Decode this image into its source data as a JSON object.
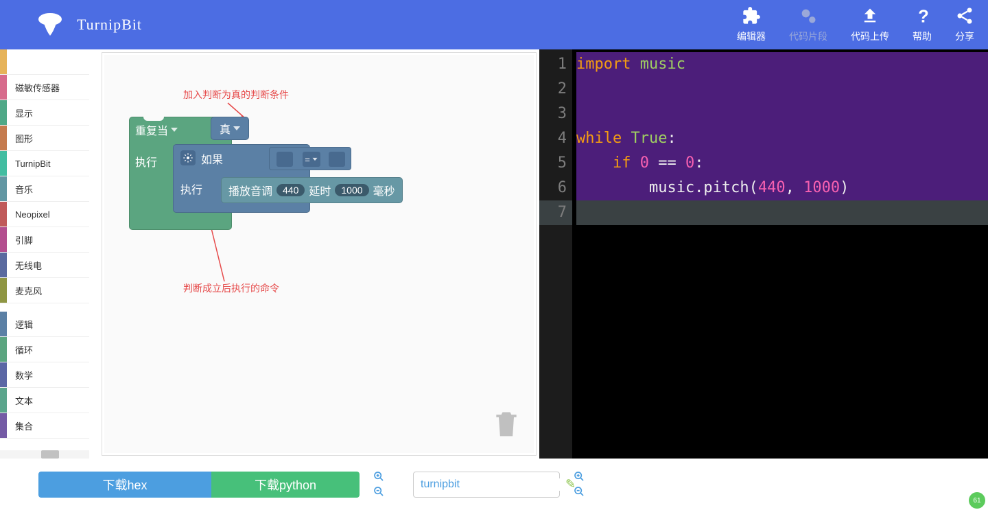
{
  "app_title": "TurnipBit",
  "nav": [
    {
      "label": "编辑器"
    },
    {
      "label": "代码片段"
    },
    {
      "label": "代码上传"
    },
    {
      "label": "帮助"
    },
    {
      "label": "分享"
    }
  ],
  "sidebar": [
    {
      "label": "",
      "color": "#E6B35A"
    },
    {
      "label": "磁敏传感器",
      "color": "#D76B8C"
    },
    {
      "label": "显示",
      "color": "#4FA887"
    },
    {
      "label": "图形",
      "color": "#C57B4E"
    },
    {
      "label": "TurnipBit",
      "color": "#42BDA1"
    },
    {
      "label": "音乐",
      "color": "#6297A3"
    },
    {
      "label": "Neopixel",
      "color": "#C05A5A"
    },
    {
      "label": "引脚",
      "color": "#B34F8F"
    },
    {
      "label": "无线电",
      "color": "#5A6A9F"
    },
    {
      "label": "麦克风",
      "color": "#8F9643"
    },
    {
      "label": "",
      "color": "transparent"
    },
    {
      "label": "逻辑",
      "color": "#5B80A5"
    },
    {
      "label": "循环",
      "color": "#5BA580"
    },
    {
      "label": "数学",
      "color": "#5B67A5"
    },
    {
      "label": "文本",
      "color": "#5BA58C"
    },
    {
      "label": "集合",
      "color": "#745BA5"
    }
  ],
  "blocks": {
    "loop_header": "重复当",
    "true_val": "真",
    "do": "执行",
    "if_label": "如果",
    "eq": "=",
    "pitch_prefix": "播放音调",
    "pitch_freq": "440",
    "pitch_delay_label": "延时",
    "pitch_delay": "1000",
    "pitch_suffix": "毫秒"
  },
  "annotations": {
    "top": "加入判断为真的判断条件",
    "bottom": "判断成立后执行的命令"
  },
  "code": {
    "lines": [
      "1",
      "2",
      "3",
      "4",
      "5",
      "6",
      "7"
    ],
    "l1_a": "import ",
    "l1_b": "music",
    "l4_a": "while ",
    "l4_b": "True",
    "l4_c": ":",
    "l5_a": "    if ",
    "l5_b": "0",
    "l5_c": " == ",
    "l5_d": "0",
    "l5_e": ":",
    "l6_a": "        music.pitch(",
    "l6_b": "440",
    "l6_c": ", ",
    "l6_d": "1000",
    "l6_e": ")"
  },
  "footer": {
    "btn_hex": "下载hex",
    "btn_py": "下载python",
    "filename": "turnipbit"
  },
  "badge": "61"
}
